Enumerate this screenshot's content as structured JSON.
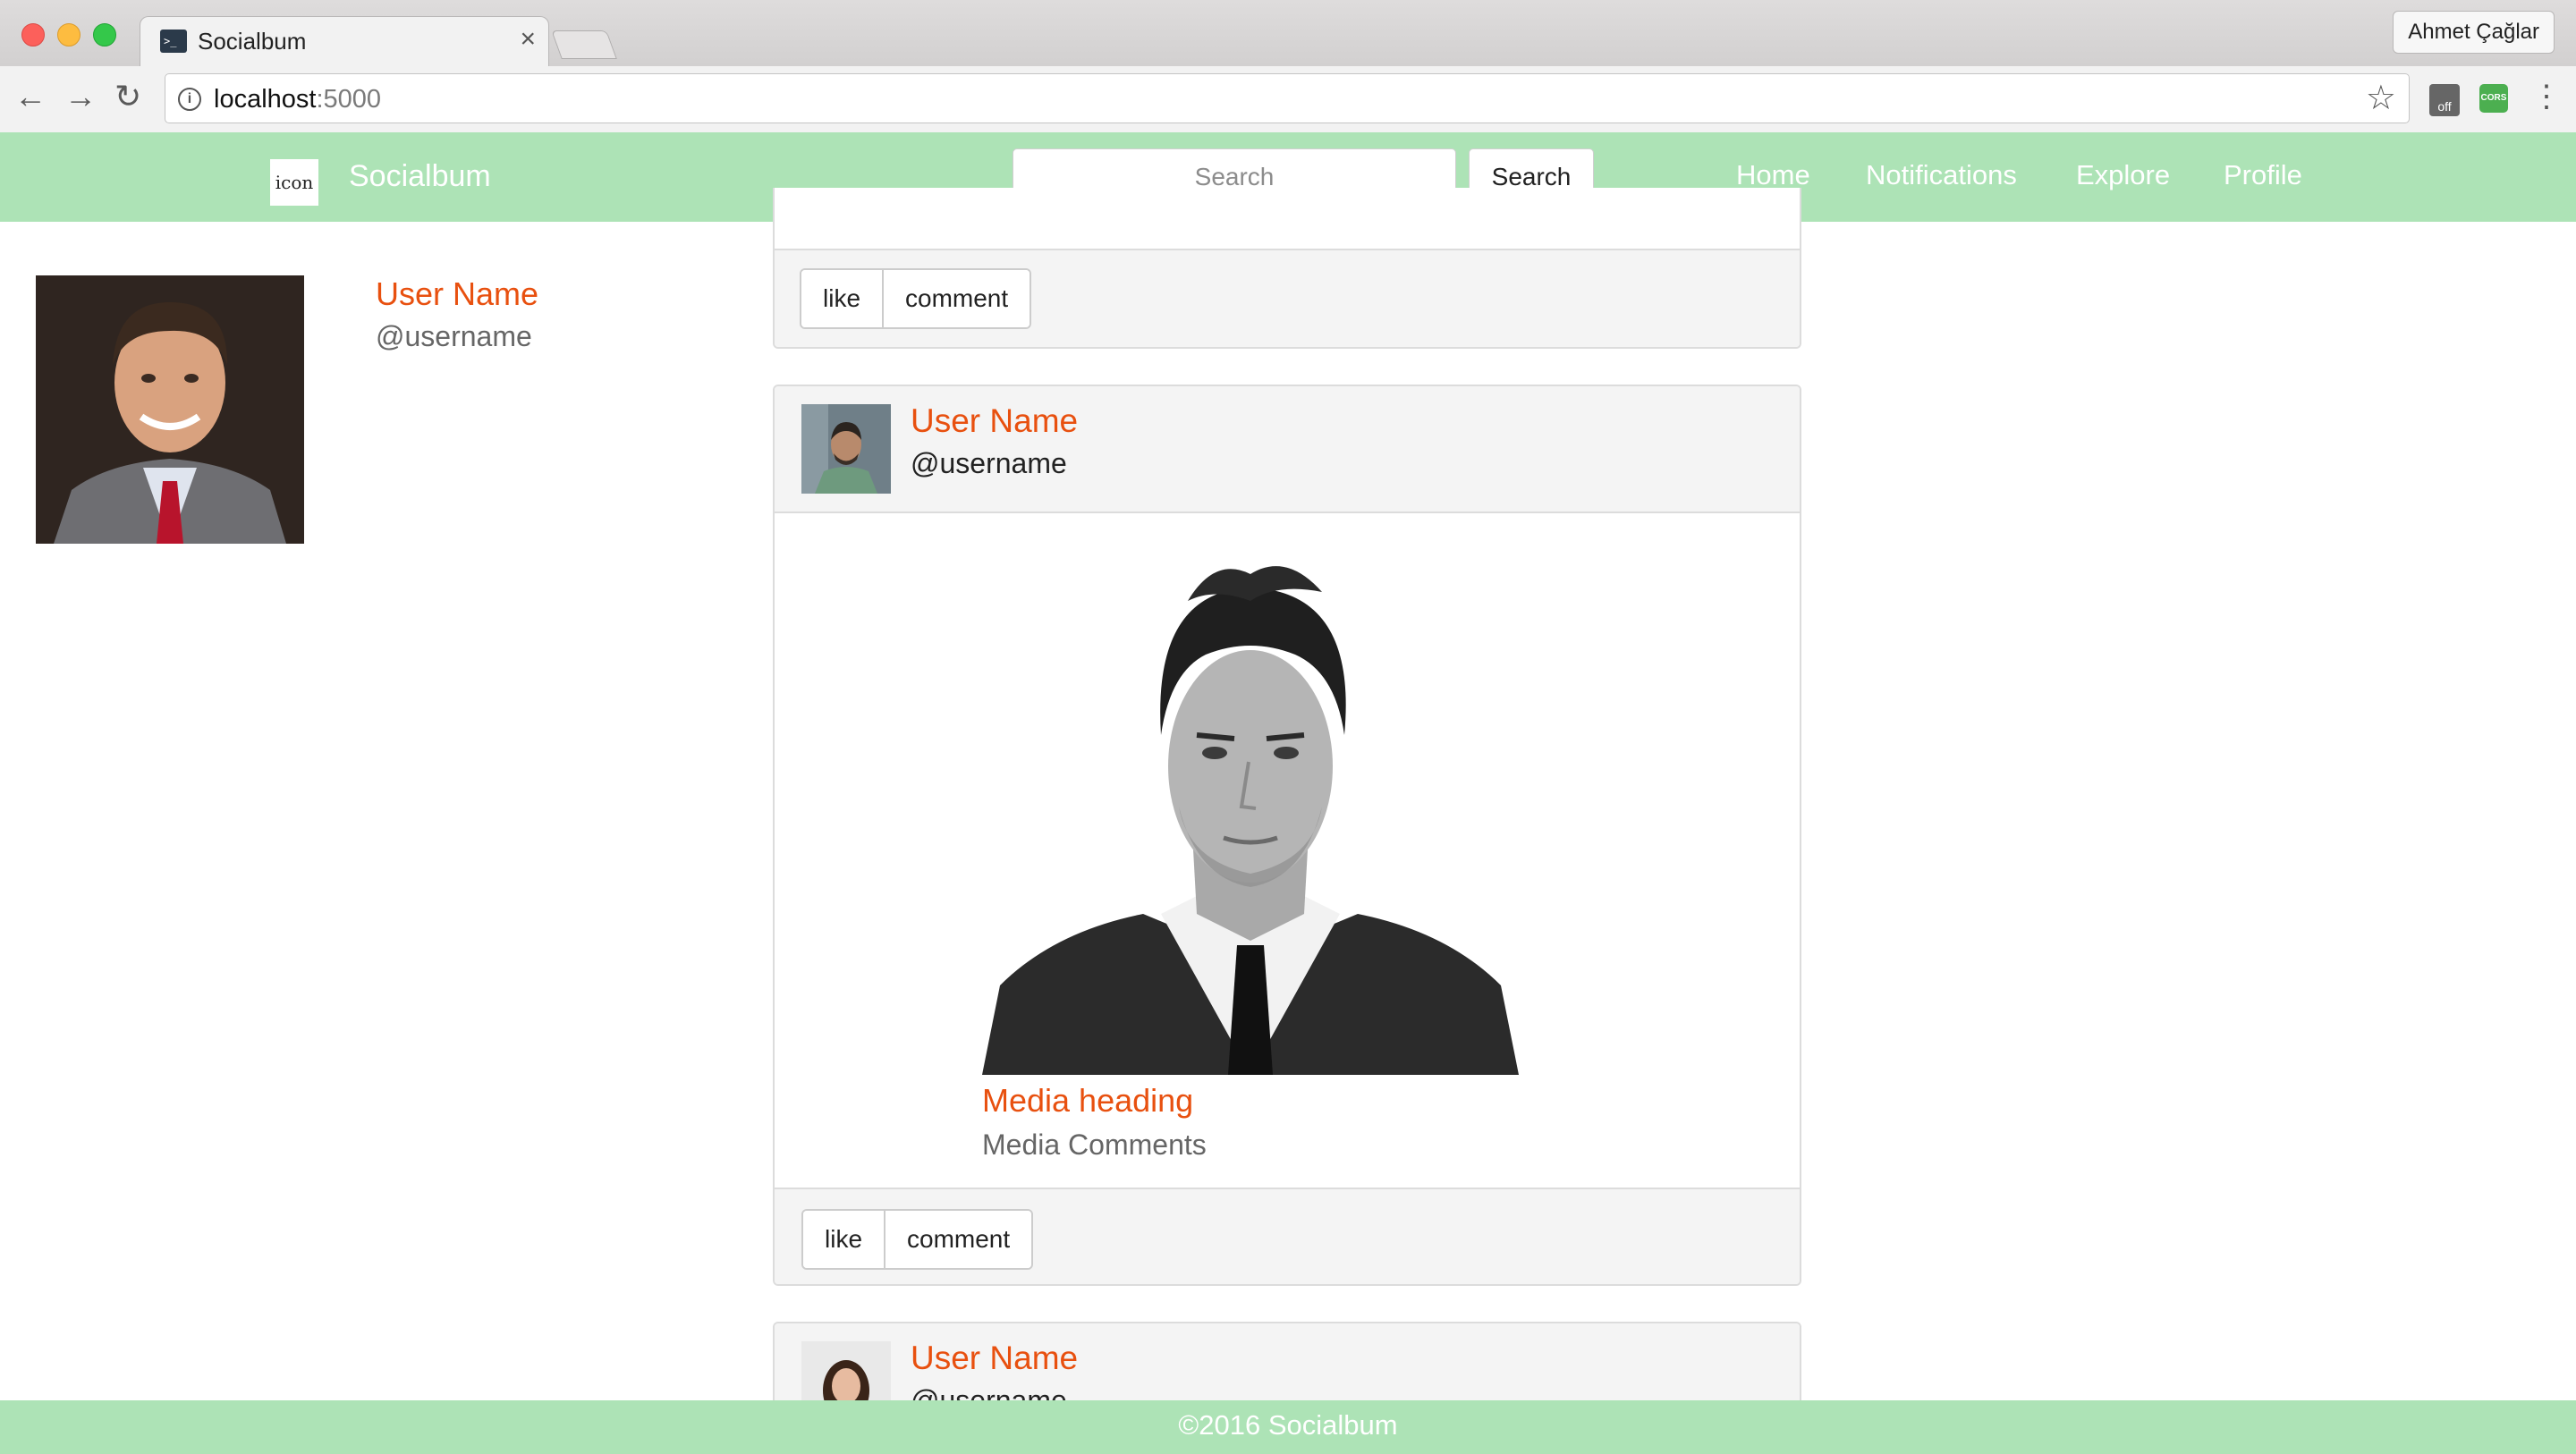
{
  "browser": {
    "tab_title": "Socialbum",
    "tab_close": "×",
    "profile_name": "Ahmet Çağlar",
    "url_host": "localhost",
    "url_port": ":5000"
  },
  "navbar": {
    "brand_icon_text": "icon",
    "brand_name": "Socialbum",
    "search_placeholder": "Search",
    "search_button": "Search",
    "links": [
      "Home",
      "Notifications",
      "Explore",
      "Profile"
    ]
  },
  "sidebar": {
    "name": "User Name",
    "handle": "@username"
  },
  "feed": {
    "top_panel": {
      "like": "like",
      "comment": "comment"
    },
    "post": {
      "name": "User Name",
      "handle": "@username",
      "media_heading": "Media heading",
      "media_comments": "Media Comments",
      "like": "like",
      "comment": "comment"
    },
    "next_post": {
      "name": "User Name",
      "handle": "@username"
    }
  },
  "footer": {
    "text": "©2016 Socialbum"
  },
  "colors": {
    "navbar": "#ade3b6",
    "accent": "#e8500f"
  },
  "icons": [
    "terminal-favicon",
    "back-arrow-icon",
    "forward-arrow-icon",
    "reload-icon",
    "info-icon",
    "star-icon",
    "cors-extension-icon",
    "menu-dots-icon"
  ]
}
